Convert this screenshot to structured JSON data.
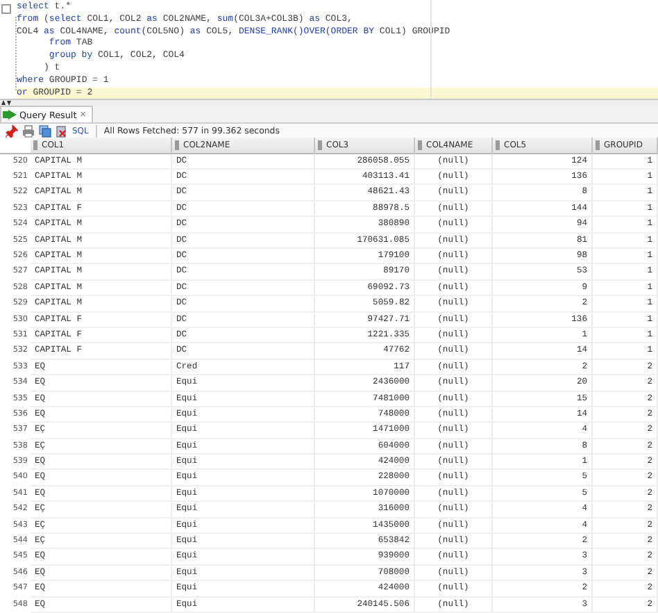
{
  "editor": {
    "lines": [
      {
        "current": false,
        "tokens": [
          {
            "kind": "keyword",
            "text": "select"
          },
          {
            "kind": "plain",
            "text": " t.*"
          }
        ]
      },
      {
        "current": false,
        "tokens": [
          {
            "kind": "keyword",
            "text": "from"
          },
          {
            "kind": "plain",
            "text": " ("
          },
          {
            "kind": "keyword",
            "text": "select"
          },
          {
            "kind": "plain",
            "text": " COL1, COL2 "
          },
          {
            "kind": "keyword",
            "text": "as"
          },
          {
            "kind": "plain",
            "text": " COL2NAME, "
          },
          {
            "kind": "keyword",
            "text": "sum"
          },
          {
            "kind": "plain",
            "text": "(COL3A+COL3B) "
          },
          {
            "kind": "keyword",
            "text": "as"
          },
          {
            "kind": "plain",
            "text": " COL3,"
          }
        ]
      },
      {
        "current": false,
        "tokens": [
          {
            "kind": "plain",
            "text": "COL4 "
          },
          {
            "kind": "keyword",
            "text": "as"
          },
          {
            "kind": "plain",
            "text": " COL4NAME, "
          },
          {
            "kind": "keyword",
            "text": "count"
          },
          {
            "kind": "plain",
            "text": "(COL5NO) "
          },
          {
            "kind": "keyword",
            "text": "as"
          },
          {
            "kind": "plain",
            "text": " COL5, "
          },
          {
            "kind": "keyword",
            "text": "DENSE_RANK()OVER(ORDER BY"
          },
          {
            "kind": "plain",
            "text": " COL1) GROUPID"
          }
        ]
      },
      {
        "current": false,
        "tokens": [
          {
            "kind": "keyword",
            "text": "      from"
          },
          {
            "kind": "plain",
            "text": " TAB"
          }
        ]
      },
      {
        "current": false,
        "tokens": [
          {
            "kind": "keyword",
            "text": "      group by"
          },
          {
            "kind": "plain",
            "text": " COL1, COL2, COL4"
          }
        ]
      },
      {
        "current": false,
        "tokens": [
          {
            "kind": "plain",
            "text": "     ) t"
          }
        ]
      },
      {
        "current": false,
        "tokens": [
          {
            "kind": "keyword",
            "text": "where"
          },
          {
            "kind": "plain",
            "text": " GROUPID = 1"
          }
        ]
      },
      {
        "current": true,
        "tokens": [
          {
            "kind": "keyword",
            "text": "or"
          },
          {
            "kind": "plain",
            "text": " GROUPID = 2"
          }
        ]
      }
    ]
  },
  "results_tab": {
    "label": "Query Result",
    "close": "×",
    "selected": true
  },
  "toolbar": {
    "sql_label": "SQL",
    "status": "All Rows Fetched: 577 in 99.362 seconds"
  },
  "table": {
    "columns": [
      "COL1",
      "COL2NAME",
      "COL3",
      "COL4NAME",
      "COL5",
      "GROUPID"
    ],
    "rows": [
      {
        "number": "520",
        "cells": [
          "CAPITAL M",
          "DC",
          "286058.055",
          "(null)",
          "124",
          "1"
        ]
      },
      {
        "number": "521",
        "cells": [
          "CAPITAL M",
          "DC",
          "403113.41",
          "(null)",
          "136",
          "1"
        ]
      },
      {
        "number": "522",
        "cells": [
          "CAPITAL M",
          "DC",
          "48621.43",
          "(null)",
          "8",
          "1"
        ]
      },
      {
        "number": "523",
        "cells": [
          "CAPITAL F",
          "DC",
          "88978.5",
          "(null)",
          "144",
          "1"
        ]
      },
      {
        "number": "524",
        "cells": [
          "CAPITAL M",
          "DC",
          "380890",
          "(null)",
          "94",
          "1"
        ]
      },
      {
        "number": "525",
        "cells": [
          "CAPITAL M",
          "DC",
          "170631.085",
          "(null)",
          "81",
          "1"
        ]
      },
      {
        "number": "526",
        "cells": [
          "CAPITAL M",
          "DC",
          "179100",
          "(null)",
          "98",
          "1"
        ]
      },
      {
        "number": "527",
        "cells": [
          "CAPITAL M",
          "DC",
          "89170",
          "(null)",
          "53",
          "1"
        ]
      },
      {
        "number": "528",
        "cells": [
          "CAPITAL M",
          "DC",
          "69092.73",
          "(null)",
          "9",
          "1"
        ]
      },
      {
        "number": "529",
        "cells": [
          "CAPITAL M",
          "DC",
          "5059.82",
          "(null)",
          "2",
          "1"
        ]
      },
      {
        "number": "530",
        "cells": [
          "CAPITAL F",
          "DC",
          "97427.71",
          "(null)",
          "136",
          "1"
        ]
      },
      {
        "number": "531",
        "cells": [
          "CAPITAL F",
          "DC",
          "1221.335",
          "(null)",
          "1",
          "1"
        ]
      },
      {
        "number": "532",
        "cells": [
          "CAPITAL F",
          "DC",
          "47762",
          "(null)",
          "14",
          "1"
        ]
      },
      {
        "number": "533",
        "cells": [
          "EQ",
          "Cred",
          "117",
          "(null)",
          "2",
          "2"
        ]
      },
      {
        "number": "534",
        "cells": [
          "EQ",
          "Equi",
          "2436000",
          "(null)",
          "20",
          "2"
        ]
      },
      {
        "number": "535",
        "cells": [
          "EQ",
          "Equi",
          "7481000",
          "(null)",
          "15",
          "2"
        ]
      },
      {
        "number": "536",
        "cells": [
          "EQ",
          "Equi",
          "748000",
          "(null)",
          "14",
          "2"
        ]
      },
      {
        "number": "537",
        "cells": [
          "EÇ",
          "Equi",
          "1471000",
          "(null)",
          "4",
          "2"
        ]
      },
      {
        "number": "538",
        "cells": [
          "EÇ",
          "Equi",
          "604000",
          "(null)",
          "8",
          "2"
        ]
      },
      {
        "number": "539",
        "cells": [
          "EQ",
          "Equi",
          "424000",
          "(null)",
          "1",
          "2"
        ]
      },
      {
        "number": "540",
        "cells": [
          "EQ",
          "Equi",
          "228000",
          "(null)",
          "5",
          "2"
        ]
      },
      {
        "number": "541",
        "cells": [
          "EQ",
          "Equi",
          "1070000",
          "(null)",
          "5",
          "2"
        ]
      },
      {
        "number": "542",
        "cells": [
          "EÇ",
          "Equi",
          "316000",
          "(null)",
          "4",
          "2"
        ]
      },
      {
        "number": "543",
        "cells": [
          "EÇ",
          "Equi",
          "1435000",
          "(null)",
          "4",
          "2"
        ]
      },
      {
        "number": "544",
        "cells": [
          "EÇ",
          "Equi",
          "653842",
          "(null)",
          "2",
          "2"
        ]
      },
      {
        "number": "545",
        "cells": [
          "EQ",
          "Equi",
          "939000",
          "(null)",
          "3",
          "2"
        ]
      },
      {
        "number": "546",
        "cells": [
          "EQ",
          "Equi",
          "708000",
          "(null)",
          "3",
          "2"
        ]
      },
      {
        "number": "547",
        "cells": [
          "EQ",
          "Equi",
          "424000",
          "(null)",
          "2",
          "2"
        ]
      },
      {
        "number": "548",
        "cells": [
          "EQ",
          "Equi",
          "240145.506",
          "(null)",
          "3",
          "2"
        ]
      }
    ]
  }
}
